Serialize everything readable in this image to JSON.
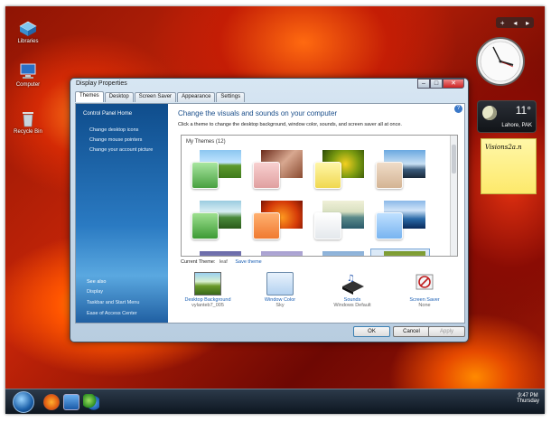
{
  "desktop": {
    "icons": [
      {
        "label": "Libraries"
      },
      {
        "label": "Computer"
      },
      {
        "label": "Recycle Bin"
      }
    ]
  },
  "gadgets": {
    "weather": {
      "temp": "11°",
      "location": "Lahore, PAK"
    },
    "note": {
      "text": "Visions2a.n"
    }
  },
  "taskbar": {
    "time": "9:47 PM",
    "day": "Thursday"
  },
  "window": {
    "title": "Display Properties",
    "tabs": [
      "Themes",
      "Desktop",
      "Screen Saver",
      "Appearance",
      "Settings"
    ],
    "active_tab": "Themes",
    "left_pane": {
      "home": "Control Panel Home",
      "links": [
        "Change desktop icons",
        "Change mouse pointers",
        "Change your account picture"
      ],
      "see_also_header": "See also",
      "see_also": [
        "Display",
        "Taskbar and Start Menu",
        "Ease of Access Center"
      ]
    },
    "main": {
      "title": "Change the visuals and sounds on your computer",
      "description": "Click a theme to change the desktop background, window color, sounds, and screen saver all at once.",
      "group_label": "My Themes (12)",
      "current_theme_label": "Current Theme:",
      "current_theme_name": "leaf",
      "save_theme": "Save theme",
      "settings": [
        {
          "label": "Desktop Background",
          "value": "vylanteb7_005",
          "icon": "desktop-background-icon"
        },
        {
          "label": "Window Color",
          "value": "Sky",
          "icon": "window-color-icon"
        },
        {
          "label": "Sounds",
          "value": "Windows Default",
          "icon": "sounds-icon"
        },
        {
          "label": "Screen Saver",
          "value": "None",
          "icon": "screen-saver-icon"
        }
      ]
    },
    "buttons": {
      "ok": "OK",
      "cancel": "Cancel",
      "apply": "Apply"
    }
  },
  "colors": {
    "accent": "#1a5fb4",
    "left_pane": "#2a7ac2"
  }
}
